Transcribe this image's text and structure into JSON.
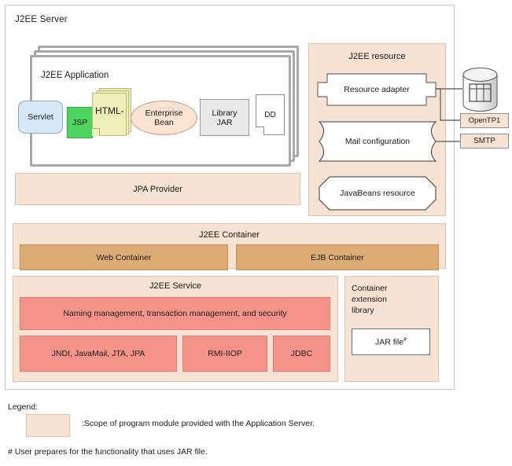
{
  "server": {
    "title": "J2EE Server"
  },
  "application": {
    "title": "J2EE Application",
    "modules": {
      "servlet": "Servlet",
      "jsp": "JSP",
      "html": "HTML-",
      "enterprise_bean": "Enterprise\nBean",
      "enterprise_bean_line1": "Enterprise",
      "enterprise_bean_line2": "Bean",
      "library_jar_line1": "Library",
      "library_jar_line2": "JAR",
      "dd": "DD"
    }
  },
  "jpa_provider": "JPA Provider",
  "j2ee_resource": {
    "title": "J2EE resource",
    "items": [
      {
        "label": "Resource adapter",
        "shape": "resource-adapter"
      },
      {
        "label": "Mail configuration",
        "shape": "concave-corner"
      },
      {
        "label": "JavaBeans resource",
        "shape": "octagon"
      }
    ]
  },
  "external": {
    "database_icon": "database-cylinder-icon",
    "opentp1": "OpenTP1",
    "smtp": "SMTP"
  },
  "j2ee_container": {
    "title": "J2EE Container",
    "web_container": "Web Container",
    "ejb_container": "EJB Container"
  },
  "j2ee_service": {
    "title": "J2EE Service",
    "wide": "Naming management, transaction management, and security",
    "blocks": [
      "JNDI, JavaMail, JTA, JPA",
      "RMI-IIOP",
      "JDBC"
    ]
  },
  "container_extension_library": {
    "title": "Container\nextension\nlibrary",
    "title_line1": "Container",
    "title_line2": "extension",
    "title_line3": "library",
    "jar_file": "JAR file",
    "jar_file_marker": "#"
  },
  "legend": {
    "heading": "Legend:",
    "swatch_description": ":Scope of program module provided with the Application Server.",
    "footnote": "# User prepares for the functionality that uses JAR file."
  },
  "colors": {
    "peach": "#f7e3d3",
    "tan": "#ddab74",
    "salmon": "#f59389",
    "servlet_blue": "#d7e9f7",
    "jsp_green": "#4cd45f",
    "html_yellow": "#eeeeb8",
    "bean_peach": "#fbe3d2",
    "jar_gray": "#e9e9e9"
  }
}
